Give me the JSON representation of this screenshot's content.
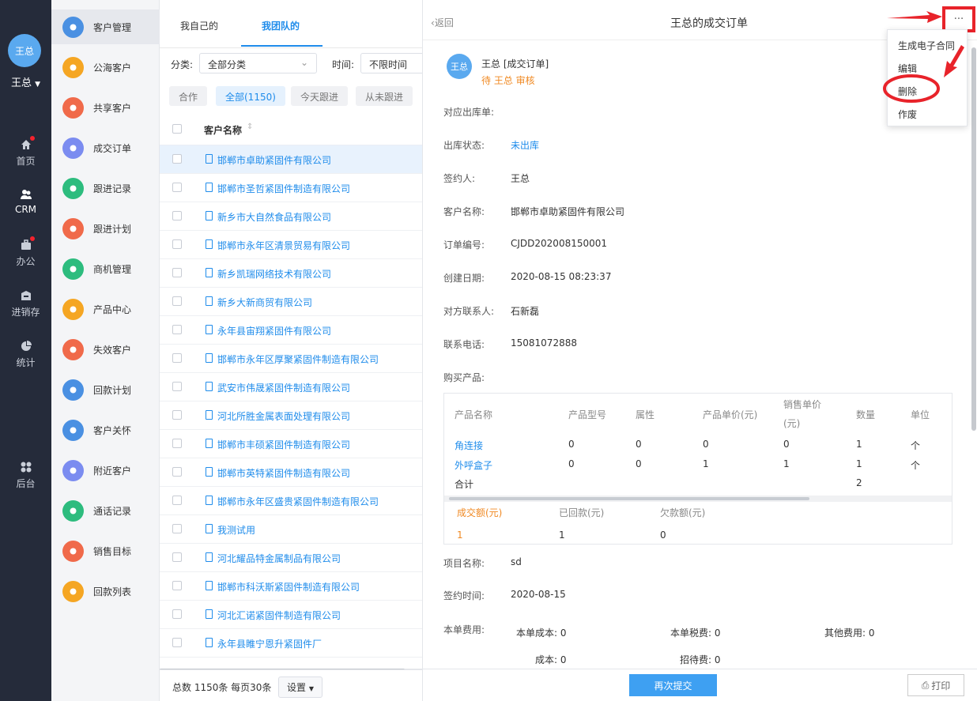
{
  "user": {
    "avatar_text": "王总",
    "name": "王总"
  },
  "left_nav": [
    {
      "label": "首页",
      "icon": "home-icon",
      "dot": true
    },
    {
      "label": "CRM",
      "icon": "crm-icon",
      "dot": false,
      "active": true
    },
    {
      "label": "办公",
      "icon": "briefcase-icon",
      "dot": true
    },
    {
      "label": "进销存",
      "icon": "warehouse-icon",
      "dot": false
    },
    {
      "label": "统计",
      "icon": "pie-chart-icon",
      "dot": false
    },
    {
      "label": "后台",
      "icon": "apps-icon",
      "dot": false
    }
  ],
  "module_menu": [
    {
      "label": "客户管理",
      "icon": "customers-icon",
      "color": "#4a90e2"
    },
    {
      "label": "公海客户",
      "icon": "public-customer-icon",
      "color": "#f5a623"
    },
    {
      "label": "共享客户",
      "icon": "share-customer-icon",
      "color": "#f06a4a"
    },
    {
      "label": "成交订单",
      "icon": "order-icon",
      "color": "#7b8cf0"
    },
    {
      "label": "跟进记录",
      "icon": "followup-record-icon",
      "color": "#2dbc7e"
    },
    {
      "label": "跟进计划",
      "icon": "followup-plan-icon",
      "color": "#f06a4a"
    },
    {
      "label": "商机管理",
      "icon": "opportunity-icon",
      "color": "#2dbc7e"
    },
    {
      "label": "产品中心",
      "icon": "product-icon",
      "color": "#f5a623"
    },
    {
      "label": "失效客户",
      "icon": "warning-icon",
      "color": "#f06a4a"
    },
    {
      "label": "回款计划",
      "icon": "payment-plan-icon",
      "color": "#4a90e2"
    },
    {
      "label": "客户关怀",
      "icon": "care-icon",
      "color": "#4a90e2"
    },
    {
      "label": "附近客户",
      "icon": "location-icon",
      "color": "#7b8cf0"
    },
    {
      "label": "通话记录",
      "icon": "phone-icon",
      "color": "#2dbc7e"
    },
    {
      "label": "销售目标",
      "icon": "target-icon",
      "color": "#f06a4a"
    },
    {
      "label": "回款列表",
      "icon": "payment-list-icon",
      "color": "#f5a623"
    }
  ],
  "list": {
    "tabs": [
      "我自己的",
      "我团队的"
    ],
    "filter_category_label": "分类:",
    "filter_category_value": "全部分类",
    "filter_time_label": "时间:",
    "filter_time_value": "不限时间",
    "chips": [
      "合作",
      "全部(1150)",
      "今天跟进",
      "从未跟进"
    ],
    "column_header": "客户名称",
    "rows": [
      "邯郸市卓助紧固件有限公司",
      "邯郸市圣哲紧固件制造有限公司",
      "新乡市大自然食品有限公司",
      "邯郸市永年区清景贸易有限公司",
      "新乡凯瑞网络技术有限公司",
      "新乡大新商贸有限公司",
      "永年县宙翔紧固件有限公司",
      "邯郸市永年区厚聚紧固件制造有限公司",
      "武安市伟晟紧固件制造有限公司",
      "河北所胜金属表面处理有限公司",
      "邯郸市丰硕紧固件制造有限公司",
      "邯郸市英特紧固件制造有限公司",
      "邯郸市永年区盛贵紧固件制造有限公司",
      "我测试用",
      "河北耀品特金属制品有限公司",
      "邯郸市科沃斯紧固件制造有限公司",
      "河北汇诺紧固件制造有限公司",
      "永年县睢宁恩升紧固件厂"
    ],
    "footer_text": "总数 1150条 每页30条",
    "settings_label": "设置"
  },
  "detail": {
    "back_label": "返回",
    "title": "王总的成交订单",
    "more_label": "···",
    "menu": [
      "生成电子合同",
      "编辑",
      "删除",
      "作废"
    ],
    "author_avatar": "王总",
    "author_line": "王总 [成交订单]",
    "status_line": "待 王总 审核",
    "fields": [
      {
        "label": "对应出库单:",
        "value": ""
      },
      {
        "label": "出库状态:",
        "value": "未出库",
        "link": true
      },
      {
        "label": "签约人:",
        "value": "王总"
      },
      {
        "label": "客户名称:",
        "value": "邯郸市卓助紧固件有限公司"
      },
      {
        "label": "订单编号:",
        "value": "CJDD202008150001"
      },
      {
        "label": "创建日期:",
        "value": "2020-08-15 08:23:37"
      },
      {
        "label": "对方联系人:",
        "value": "石新磊"
      },
      {
        "label": "联系电话:",
        "value": "15081072888"
      },
      {
        "label": "购买产品:",
        "value": ""
      }
    ],
    "product_table": {
      "headers": [
        "产品名称",
        "产品型号",
        "属性",
        "产品单价(元)",
        "销售单价",
        "(元)",
        "数量",
        "单位"
      ],
      "rows": [
        [
          "角连接",
          "0",
          "0",
          "0",
          "0",
          "1",
          "个"
        ],
        [
          "外呼盒子",
          "0",
          "0",
          "1",
          "1",
          "1",
          "个"
        ]
      ],
      "total_label": "合计",
      "total_qty": "2",
      "summary_headers": [
        "成交额(元)",
        "已回款(元)",
        "欠款额(元)"
      ],
      "summary_values": [
        "1",
        "1",
        "0"
      ]
    },
    "project_label": "项目名称:",
    "project_value": "sd",
    "sign_time_label": "签约时间:",
    "sign_time_value": "2020-08-15",
    "cost_label": "本单费用:",
    "costs": [
      "本单成本: 0",
      "本单税费: 0",
      "其他费用: 0",
      "成本: 0",
      "招待费: 0"
    ],
    "resubmit_label": "再次提交",
    "print_label": "打印"
  },
  "colors": {
    "accent": "#1f8ceb",
    "nav_bg": "#252b3a",
    "highlight_red": "#e8232a",
    "orange": "#f08a24"
  }
}
